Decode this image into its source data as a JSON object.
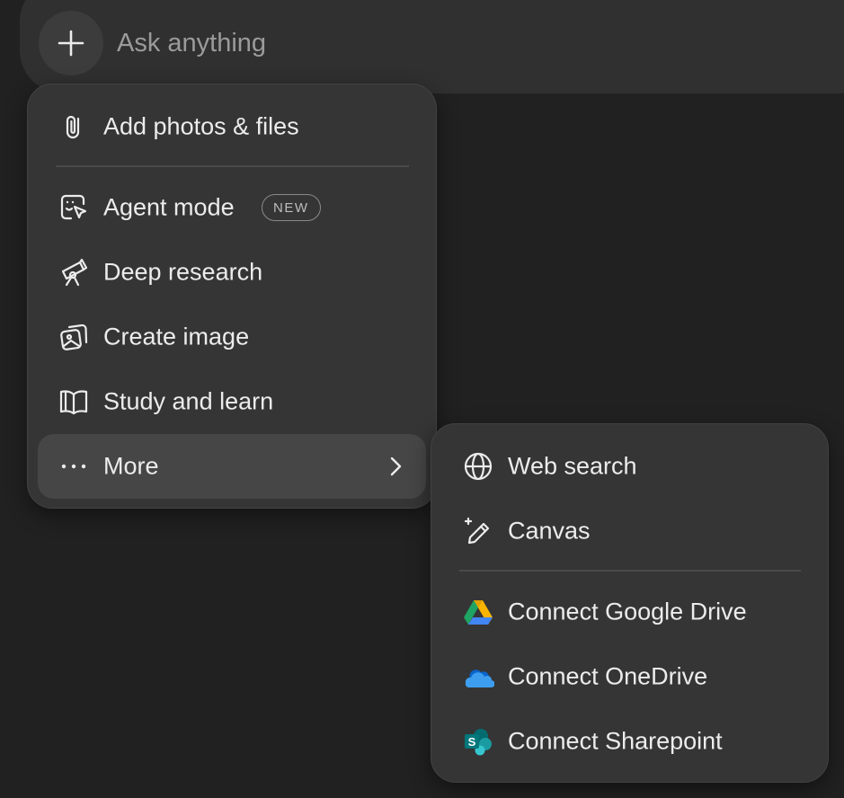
{
  "composer": {
    "placeholder": "Ask anything",
    "plus_icon": "plus-icon"
  },
  "menu": {
    "items": [
      {
        "label": "Add photos & files",
        "icon": "paperclip-icon"
      },
      {
        "label": "Agent mode",
        "icon": "agent-cursor-icon",
        "badge": "NEW"
      },
      {
        "label": "Deep research",
        "icon": "telescope-icon"
      },
      {
        "label": "Create image",
        "icon": "image-stack-icon"
      },
      {
        "label": "Study and learn",
        "icon": "open-book-icon"
      },
      {
        "label": "More",
        "icon": "ellipsis-icon",
        "trailing_icon": "chevron-right-icon",
        "active": true
      }
    ]
  },
  "submenu": {
    "items": [
      {
        "label": "Web search",
        "icon": "globe-icon"
      },
      {
        "label": "Canvas",
        "icon": "pencil-sparkle-icon"
      },
      {
        "label": "Connect Google Drive",
        "icon": "google-drive-icon"
      },
      {
        "label": "Connect OneDrive",
        "icon": "onedrive-icon"
      },
      {
        "label": "Connect Sharepoint",
        "icon": "sharepoint-icon"
      }
    ]
  },
  "colors": {
    "background": "#212121",
    "composer": "#303030",
    "menu": "#353535",
    "active_item": "#464646",
    "text": "#ececec",
    "placeholder": "#9b9b9b"
  }
}
